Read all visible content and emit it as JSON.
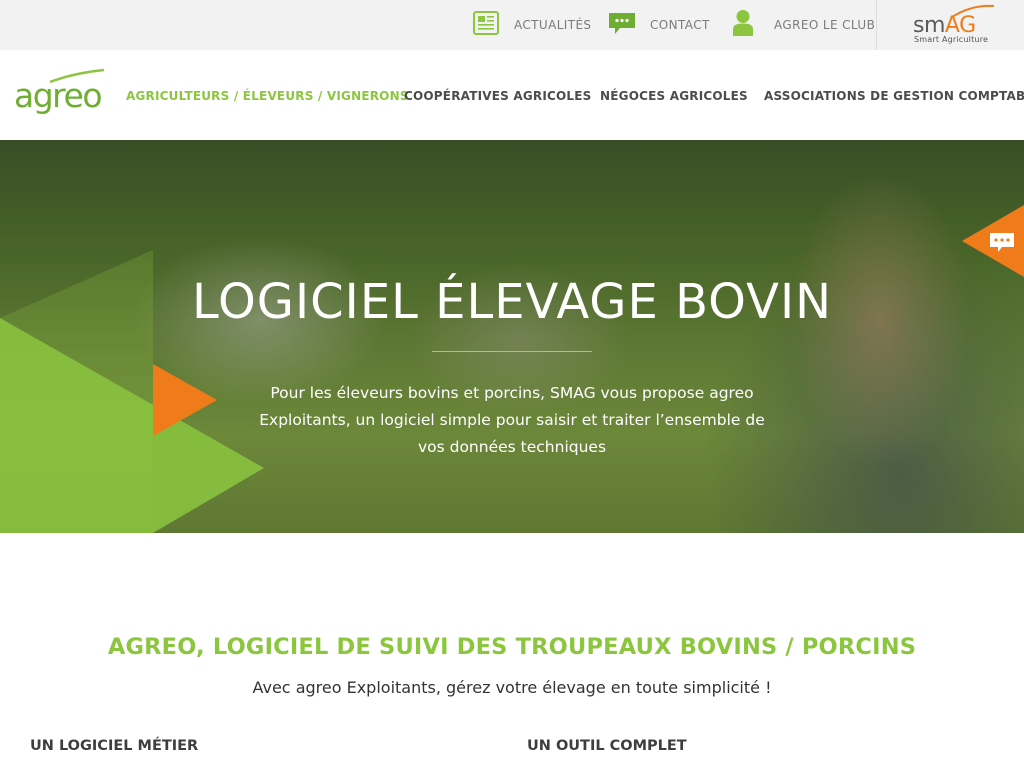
{
  "topbar": {
    "links": [
      {
        "label": "ACTUALITÉS",
        "icon": "newspaper-icon"
      },
      {
        "label": "CONTACT",
        "icon": "chat-bubble-icon"
      },
      {
        "label": "AGREO LE CLUB",
        "icon": "user-icon"
      }
    ],
    "smag": {
      "word_prefix": "sm",
      "word_suffix": "AG",
      "tagline": "Smart Agriculture"
    }
  },
  "logo": {
    "text": "agreo"
  },
  "nav": {
    "items": [
      {
        "label": "AGRICULTEURS / ÉLEVEURS / VIGNERONS",
        "active": true
      },
      {
        "label": "COOPÉRATIVES AGRICOLES",
        "active": false
      },
      {
        "label": "NÉGOCES AGRICOLES",
        "active": false
      },
      {
        "label": "ASSOCIATIONS DE GESTION COMPTABLE",
        "active": false
      }
    ]
  },
  "hero": {
    "title": "LOGICIEL ÉLEVAGE BOVIN",
    "text": "Pour les éleveurs bovins et porcins, SMAG vous propose agreo Exploitants, un logiciel simple pour saisir et traiter l’ensemble de vos données techniques",
    "chat_icon": "chat-bubble-icon"
  },
  "content": {
    "title": "AGREO, LOGICIEL DE SUIVI DES TROUPEAUX BOVINS / PORCINS",
    "subtitle": "Avec agreo Exploitants, gérez votre élevage en toute simplicité !",
    "columns": [
      {
        "title": "UN LOGICIEL MÉTIER"
      },
      {
        "title": "UN OUTIL COMPLET"
      }
    ]
  },
  "colors": {
    "brand_green": "#8cc63f",
    "brand_orange": "#f07b1a",
    "topbar_bg": "#f2f2f2"
  }
}
